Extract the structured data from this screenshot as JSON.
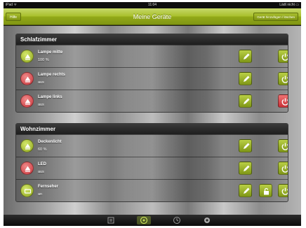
{
  "status_bar": {
    "carrier": "iPad ᯤ",
    "time": "11:04",
    "battery": "Lädt nicht ▭"
  },
  "nav": {
    "back_label": "Hilfe",
    "title": "Meine Geräte",
    "right_label": "Gerät hinzufügen / löschen"
  },
  "groups": [
    {
      "title": "Schlafzimmer",
      "items": [
        {
          "name": "Lampe mitte",
          "value": "100 %",
          "state": "on",
          "lock": false
        },
        {
          "name": "Lampe rechts",
          "value": "aus",
          "state": "off",
          "lock": false
        },
        {
          "name": "Lampe links",
          "value": "aus",
          "state": "off",
          "lock": false
        }
      ]
    },
    {
      "title": "Wohnzimmer",
      "items": [
        {
          "name": "Deckenlicht",
          "value": "60 %",
          "state": "on",
          "lock": false
        },
        {
          "name": "LED",
          "value": "aus",
          "state": "off",
          "lock": false
        },
        {
          "name": "Fernseher",
          "value": "an",
          "state": "on",
          "lock": true
        }
      ]
    }
  ],
  "colors": {
    "accent": "#93aa18",
    "off": "#c8343a"
  },
  "tabbar": {
    "icons": [
      "list-icon",
      "devices-icon",
      "clock-icon",
      "settings-icon"
    ],
    "active": 1
  }
}
